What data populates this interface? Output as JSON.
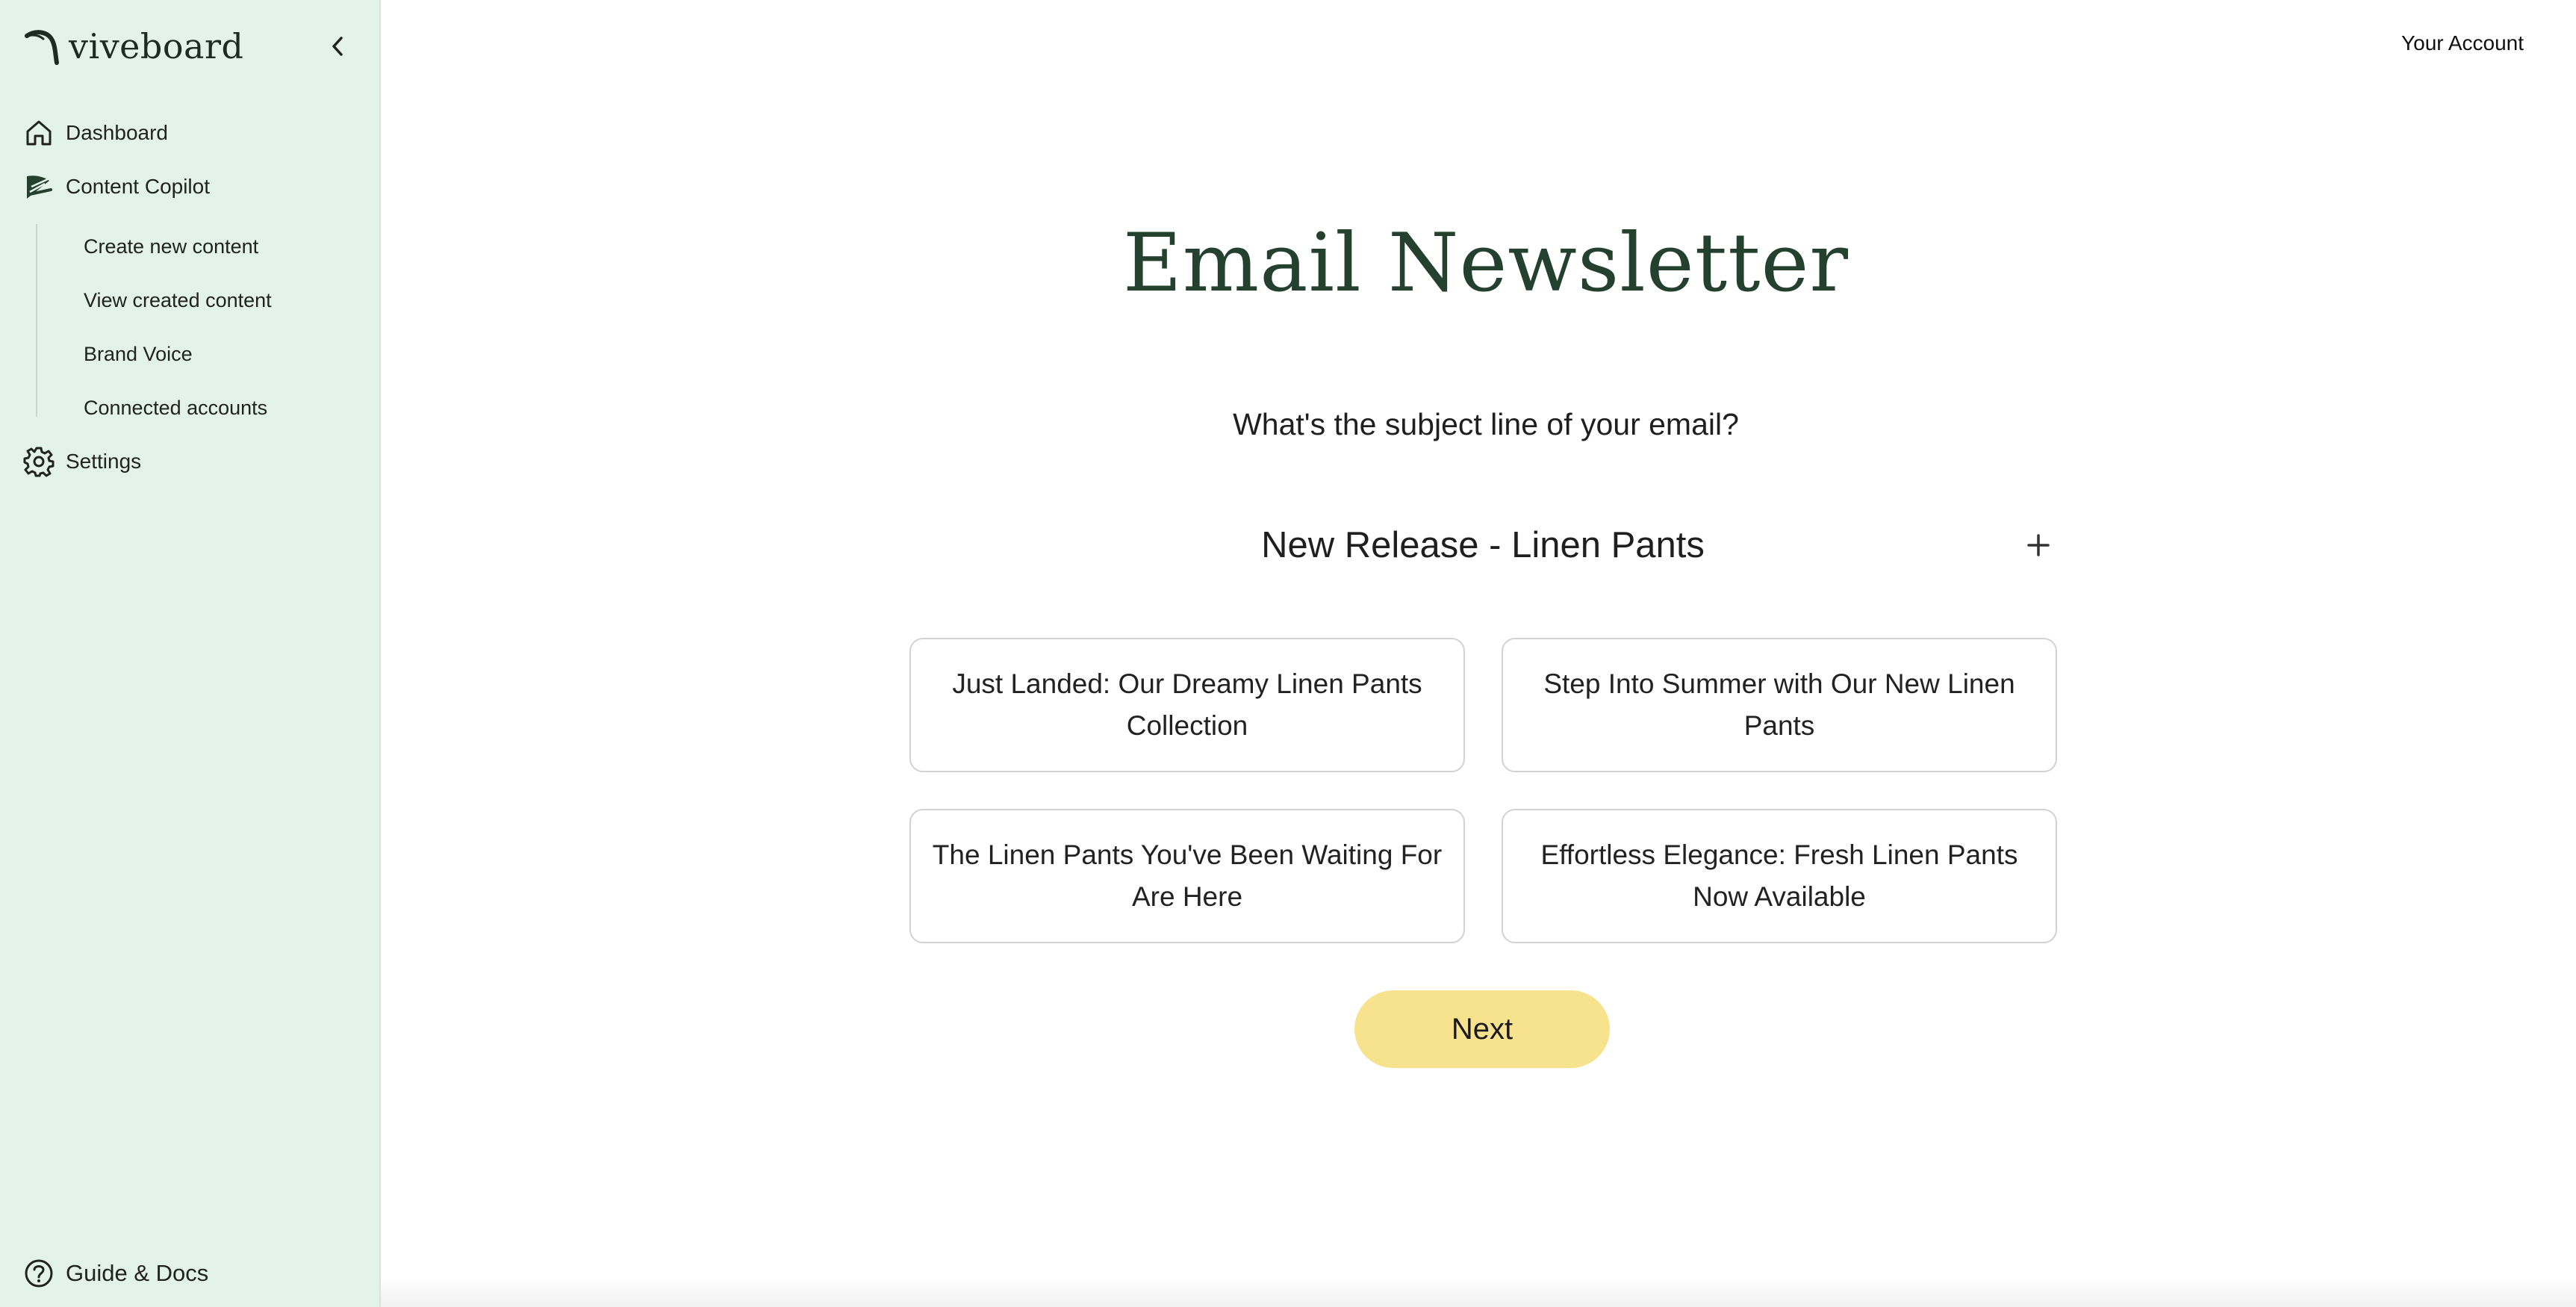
{
  "brand": {
    "name": "viveboard",
    "logo_icon": "viveboard-logo-icon"
  },
  "sidebar": {
    "collapse_icon": "chevron-left-icon",
    "items": [
      {
        "label": "Dashboard",
        "icon": "home-icon"
      },
      {
        "label": "Content Copilot",
        "icon": "feather-icon"
      },
      {
        "label": "Settings",
        "icon": "gear-icon"
      }
    ],
    "subitems": [
      {
        "label": "Create new content"
      },
      {
        "label": "View created content"
      },
      {
        "label": "Brand Voice"
      },
      {
        "label": "Connected accounts"
      }
    ],
    "guide": {
      "label": "Guide & Docs",
      "icon": "help-circle-icon"
    }
  },
  "header": {
    "account_label": "Your Account"
  },
  "main": {
    "title": "Email Newsletter",
    "question": "What's the subject line of your email?",
    "subject_value": "New Release - Linen Pants",
    "add_icon": "plus-icon",
    "suggestions": [
      "Just Landed: Our Dreamy Linen Pants Collection",
      "Step Into Summer with Our New Linen Pants",
      "The Linen Pants You've Been Waiting For Are Here",
      "Effortless Elegance: Fresh Linen Pants Now Available"
    ],
    "next_label": "Next"
  },
  "colors": {
    "sidebar_bg": "#e3f3e9",
    "title_green": "#24402f",
    "next_button": "#f7e38e",
    "card_border": "#d2d2d2"
  }
}
